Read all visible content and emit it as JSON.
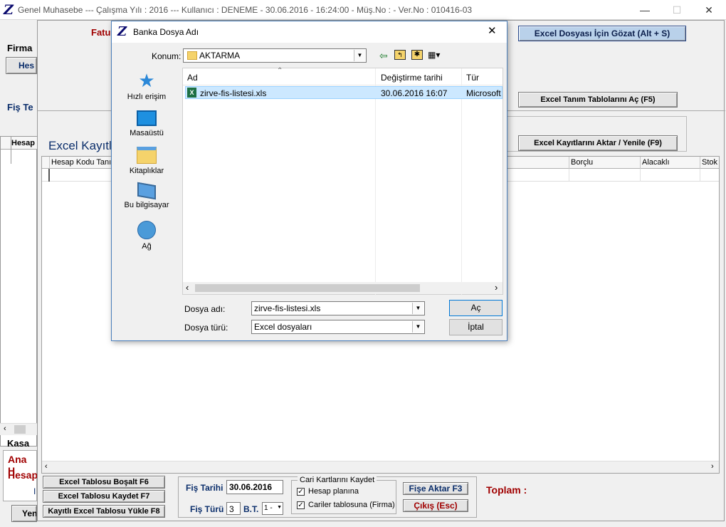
{
  "window": {
    "title": "Genel Muhasebe  ---  Çalışma Yılı : 2016  ---  Kullanıcı : DENEME - 30.06.2016 - 16:24:00 - Müş.No : - Ver.No : 010416-03",
    "minimize": "—",
    "maximize": "☐",
    "close": "✕"
  },
  "background": {
    "fatu_label": "Fatu",
    "firma_label": "Firma",
    "hes_button": "Hes",
    "fis_label": "Fiş Te",
    "hesap_col": "Hesap",
    "excel_kayit_label": "Excel Kayıtl",
    "kasa_label": "Kasa",
    "ana_h_label": "Ana H",
    "hesap_label": "Hesap",
    "i_label": "I",
    "yen_button": "Yen",
    "excel_gozat_button": "Excel Dosyası İçin Gözat (Alt + S)",
    "excel_tanim_button": "Excel Tanım Tablolarını Aç (F5)",
    "excel_aktar_button": "Excel Kayıtlarını Aktar / Yenile (F9)",
    "grid_headers": [
      "Hesap Kodu Tanımı",
      "Borçlu",
      "Alacaklı",
      "Stok"
    ],
    "bottom": {
      "bosalt_button": "Excel Tablosu Boşalt F6",
      "kaydet_button": "Excel Tablosu Kaydet F7",
      "yukle_button": "Kayıtlı Excel Tablosu Yükle F8",
      "fis_tarihi_label": "Fiş Tarihi",
      "fis_tarihi_value": "30.06.2016",
      "fis_turu_label": "Fiş Türü",
      "fis_turu_value": "3",
      "bt_label": "B.T.",
      "bt_value": "1 -",
      "cari_group_label": "Cari Kartlarını Kaydet",
      "hesap_plani_label": "Hesap planına",
      "cariler_label": "Cariler tablosuna (Firma)",
      "fise_aktar_button": "Fişe Aktar F3",
      "cikis_button": "Çıkış (Esc)",
      "toplam_label": "Toplam :"
    }
  },
  "dialog": {
    "logo": "Z",
    "title": "Banka Dosya Adı",
    "close": "✕",
    "konum_label": "Konum:",
    "konum_value": "AKTARMA",
    "nav": [
      {
        "label": "Hızlı erişim",
        "icon": "star-icon"
      },
      {
        "label": "Masaüstü",
        "icon": "desktop-icon"
      },
      {
        "label": "Kitaplıklar",
        "icon": "libraries-icon"
      },
      {
        "label": "Bu bilgisayar",
        "icon": "computer-icon"
      },
      {
        "label": "Ağ",
        "icon": "network-icon"
      }
    ],
    "columns": [
      "Ad",
      "Değiştirme tarihi",
      "Tür"
    ],
    "files": [
      {
        "name": "zirve-fis-listesi.xls",
        "modified": "30.06.2016 16:07",
        "type": "Microsoft"
      }
    ],
    "filename_label": "Dosya adı:",
    "filename_value": "zirve-fis-listesi.xls",
    "filetype_label": "Dosya türü:",
    "filetype_value": "Excel dosyaları",
    "open_button": "Aç",
    "cancel_button": "İptal"
  },
  "colors": {
    "label_red": "#a00000",
    "selection": "#cce8ff",
    "accent_blue_button": "#b9d1ea"
  }
}
